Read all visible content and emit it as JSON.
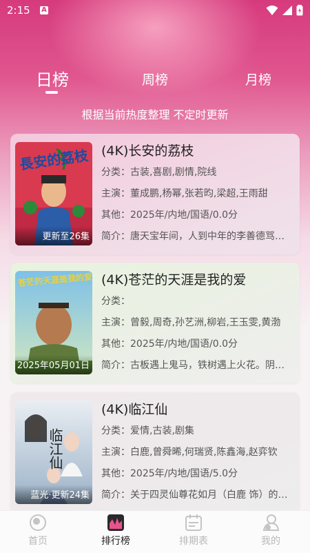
{
  "status": {
    "time": "2:15",
    "app_badge": "A"
  },
  "tabs": {
    "daily": "日榜",
    "weekly": "周榜",
    "monthly": "月榜",
    "active": "daily"
  },
  "subtitle": "根据当前热度整理 不定时更新",
  "items": [
    {
      "title": "(4K)长安的荔枝",
      "category": "分类：古装,喜剧,剧情,院线",
      "cast": "主演：董成鹏,杨幂,张若昀,梁超,王雨甜",
      "other": "其他：2025年/内地/国语/0.0分",
      "summary": "简介：唐天宝年间，人到中年的李善德骂骂咧咧接下了荔枝使的差事",
      "badge": "更新至26集",
      "poster_text": "長安的荔枝"
    },
    {
      "title": "(4K)苍茫的天涯是我的爱",
      "category": "分类：",
      "cast": "主演：曾毅,周奇,孙艺洲,柳岩,王玉雯,黄渤",
      "other": "其他：2025年/内地/国语/0.0分",
      "summary": "简介：古板遇上鬼马，铁树遇上火花。阴差阳错",
      "badge": "2025年05月01日",
      "poster_text": "苍茫的天涯是我的爱"
    },
    {
      "title": "(4K)临江仙",
      "category": "分类：爱情,古装,剧集",
      "cast": "主演：白鹿,曾舜晞,何瑞贤,陈鑫海,赵弈钦",
      "other": "其他：2025年/内地/国语/5.0分",
      "summary": "简介：关于四灵仙尊花如月（白鹿 饰）的故事",
      "badge": "蓝光·更新24集",
      "poster_text": "临江仙"
    }
  ],
  "nav": {
    "home": "首页",
    "rank": "排行榜",
    "schedule": "排期表",
    "mine": "我的",
    "active": "rank"
  },
  "colors": {
    "accent": "#d63a7d",
    "text_dark": "#222222",
    "text_muted": "#555555",
    "nav_inactive": "#b8b8b8"
  }
}
